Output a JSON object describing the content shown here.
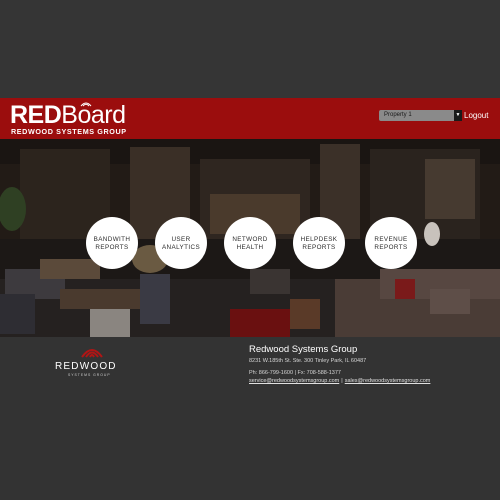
{
  "brand": {
    "logo_red": "RED",
    "logo_board": "Board",
    "logo_subtitle": "REDWOOD SYSTEMS GROUP",
    "accent_color": "#9b0d0d"
  },
  "header": {
    "property_select": "Property 1",
    "logout_label": "Logout"
  },
  "nav": [
    {
      "label": "BANDWITH\nREPORTS"
    },
    {
      "label": "USER\nANALYTICS"
    },
    {
      "label": "NETWORD\nHEALTH"
    },
    {
      "label": "HELPDESK\nREPORTS"
    },
    {
      "label": "REVENUE\nREPORTS"
    }
  ],
  "footer": {
    "logo_name": "REDWOOD",
    "logo_tagline": "SYSTEMS GROUP",
    "company": "Redwood Systems Group",
    "address": "8231 W.185th St. Ste. 300 Tinley Park, IL 60487",
    "phone": "Ph: 866-799-1600 | Fx: 708-588-1377",
    "service_email": "service@redwoodsystemsgroup.com",
    "separator": "|",
    "sales_email": "sales@redwoodsystemsgroup.com"
  }
}
